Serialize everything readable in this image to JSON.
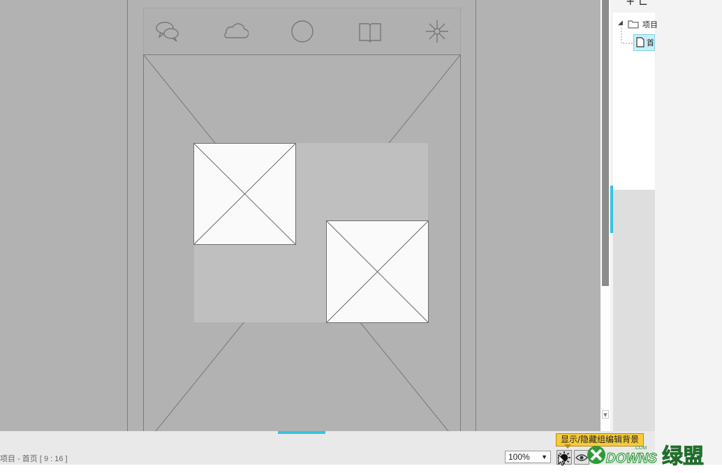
{
  "canvas": {
    "tab_bar_icons": [
      "speech-bubbles-icon",
      "cloud-icon",
      "circle-icon",
      "book-icon",
      "asterisk-icon"
    ],
    "image_placeholders": [
      "image-placeholder-1",
      "image-placeholder-2"
    ]
  },
  "sitemap": {
    "root_label": "项目",
    "page_label": "首"
  },
  "status_bar": {
    "status_text": "项目 - 首页 [ 9 : 16 ]",
    "zoom_value": "100%",
    "tooltip": "显示/隐藏组编辑背景"
  },
  "watermark": {
    "com": ".COM",
    "brand": "DOWNS",
    "cn": "绿盟"
  },
  "colors": {
    "accent": "#35c4dd",
    "canvas_bg": "#b2b2b2",
    "tooltip_bg": "#f7cc3c",
    "watermark_green": "#2d9a3a"
  }
}
